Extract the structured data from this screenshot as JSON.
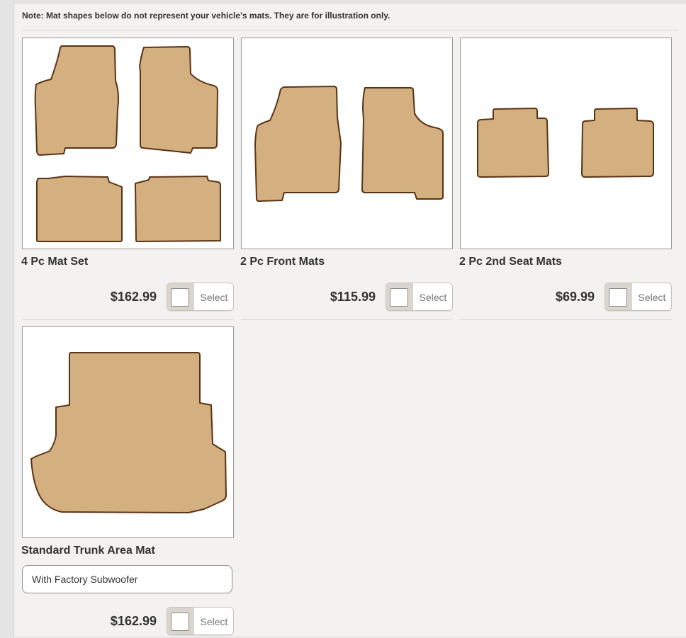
{
  "note": "Note: Mat shapes below do not represent your vehicle's mats. They are for illustration only.",
  "mat_colors": {
    "fill": "#d4b080",
    "border": "#5a3315"
  },
  "products": [
    {
      "title": "4 Pc Mat Set",
      "price": "$162.99",
      "select_label": "Select",
      "selected": false
    },
    {
      "title": "2 Pc Front Mats",
      "price": "$115.99",
      "select_label": "Select",
      "selected": false
    },
    {
      "title": "2 Pc 2nd Seat Mats",
      "price": "$69.99",
      "select_label": "Select",
      "selected": false
    },
    {
      "title": "Standard Trunk Area Mat",
      "option": "With Factory Subwoofer",
      "price": "$162.99",
      "select_label": "Select",
      "selected": false
    }
  ]
}
